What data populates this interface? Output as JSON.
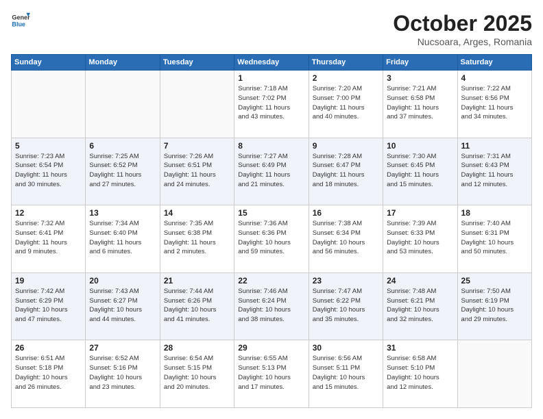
{
  "logo": {
    "general": "General",
    "blue": "Blue"
  },
  "header": {
    "month": "October 2025",
    "location": "Nucsoara, Arges, Romania"
  },
  "weekdays": [
    "Sunday",
    "Monday",
    "Tuesday",
    "Wednesday",
    "Thursday",
    "Friday",
    "Saturday"
  ],
  "weeks": [
    [
      {
        "day": "",
        "info": ""
      },
      {
        "day": "",
        "info": ""
      },
      {
        "day": "",
        "info": ""
      },
      {
        "day": "1",
        "info": "Sunrise: 7:18 AM\nSunset: 7:02 PM\nDaylight: 11 hours\nand 43 minutes."
      },
      {
        "day": "2",
        "info": "Sunrise: 7:20 AM\nSunset: 7:00 PM\nDaylight: 11 hours\nand 40 minutes."
      },
      {
        "day": "3",
        "info": "Sunrise: 7:21 AM\nSunset: 6:58 PM\nDaylight: 11 hours\nand 37 minutes."
      },
      {
        "day": "4",
        "info": "Sunrise: 7:22 AM\nSunset: 6:56 PM\nDaylight: 11 hours\nand 34 minutes."
      }
    ],
    [
      {
        "day": "5",
        "info": "Sunrise: 7:23 AM\nSunset: 6:54 PM\nDaylight: 11 hours\nand 30 minutes."
      },
      {
        "day": "6",
        "info": "Sunrise: 7:25 AM\nSunset: 6:52 PM\nDaylight: 11 hours\nand 27 minutes."
      },
      {
        "day": "7",
        "info": "Sunrise: 7:26 AM\nSunset: 6:51 PM\nDaylight: 11 hours\nand 24 minutes."
      },
      {
        "day": "8",
        "info": "Sunrise: 7:27 AM\nSunset: 6:49 PM\nDaylight: 11 hours\nand 21 minutes."
      },
      {
        "day": "9",
        "info": "Sunrise: 7:28 AM\nSunset: 6:47 PM\nDaylight: 11 hours\nand 18 minutes."
      },
      {
        "day": "10",
        "info": "Sunrise: 7:30 AM\nSunset: 6:45 PM\nDaylight: 11 hours\nand 15 minutes."
      },
      {
        "day": "11",
        "info": "Sunrise: 7:31 AM\nSunset: 6:43 PM\nDaylight: 11 hours\nand 12 minutes."
      }
    ],
    [
      {
        "day": "12",
        "info": "Sunrise: 7:32 AM\nSunset: 6:41 PM\nDaylight: 11 hours\nand 9 minutes."
      },
      {
        "day": "13",
        "info": "Sunrise: 7:34 AM\nSunset: 6:40 PM\nDaylight: 11 hours\nand 6 minutes."
      },
      {
        "day": "14",
        "info": "Sunrise: 7:35 AM\nSunset: 6:38 PM\nDaylight: 11 hours\nand 2 minutes."
      },
      {
        "day": "15",
        "info": "Sunrise: 7:36 AM\nSunset: 6:36 PM\nDaylight: 10 hours\nand 59 minutes."
      },
      {
        "day": "16",
        "info": "Sunrise: 7:38 AM\nSunset: 6:34 PM\nDaylight: 10 hours\nand 56 minutes."
      },
      {
        "day": "17",
        "info": "Sunrise: 7:39 AM\nSunset: 6:33 PM\nDaylight: 10 hours\nand 53 minutes."
      },
      {
        "day": "18",
        "info": "Sunrise: 7:40 AM\nSunset: 6:31 PM\nDaylight: 10 hours\nand 50 minutes."
      }
    ],
    [
      {
        "day": "19",
        "info": "Sunrise: 7:42 AM\nSunset: 6:29 PM\nDaylight: 10 hours\nand 47 minutes."
      },
      {
        "day": "20",
        "info": "Sunrise: 7:43 AM\nSunset: 6:27 PM\nDaylight: 10 hours\nand 44 minutes."
      },
      {
        "day": "21",
        "info": "Sunrise: 7:44 AM\nSunset: 6:26 PM\nDaylight: 10 hours\nand 41 minutes."
      },
      {
        "day": "22",
        "info": "Sunrise: 7:46 AM\nSunset: 6:24 PM\nDaylight: 10 hours\nand 38 minutes."
      },
      {
        "day": "23",
        "info": "Sunrise: 7:47 AM\nSunset: 6:22 PM\nDaylight: 10 hours\nand 35 minutes."
      },
      {
        "day": "24",
        "info": "Sunrise: 7:48 AM\nSunset: 6:21 PM\nDaylight: 10 hours\nand 32 minutes."
      },
      {
        "day": "25",
        "info": "Sunrise: 7:50 AM\nSunset: 6:19 PM\nDaylight: 10 hours\nand 29 minutes."
      }
    ],
    [
      {
        "day": "26",
        "info": "Sunrise: 6:51 AM\nSunset: 5:18 PM\nDaylight: 10 hours\nand 26 minutes."
      },
      {
        "day": "27",
        "info": "Sunrise: 6:52 AM\nSunset: 5:16 PM\nDaylight: 10 hours\nand 23 minutes."
      },
      {
        "day": "28",
        "info": "Sunrise: 6:54 AM\nSunset: 5:15 PM\nDaylight: 10 hours\nand 20 minutes."
      },
      {
        "day": "29",
        "info": "Sunrise: 6:55 AM\nSunset: 5:13 PM\nDaylight: 10 hours\nand 17 minutes."
      },
      {
        "day": "30",
        "info": "Sunrise: 6:56 AM\nSunset: 5:11 PM\nDaylight: 10 hours\nand 15 minutes."
      },
      {
        "day": "31",
        "info": "Sunrise: 6:58 AM\nSunset: 5:10 PM\nDaylight: 10 hours\nand 12 minutes."
      },
      {
        "day": "",
        "info": ""
      }
    ]
  ]
}
